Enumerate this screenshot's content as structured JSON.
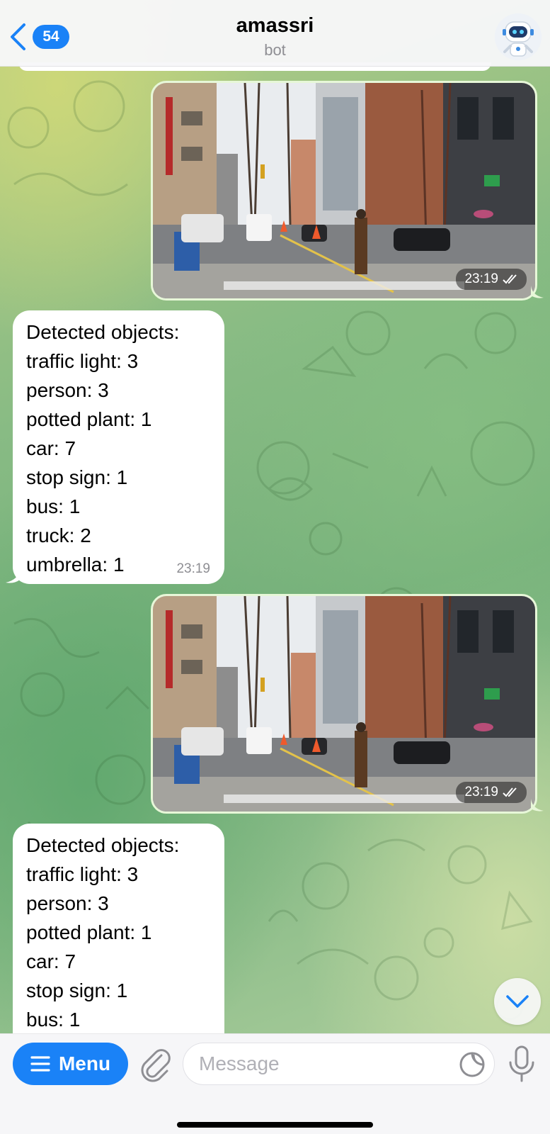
{
  "header": {
    "back_badge": "54",
    "title": "amassri",
    "subtitle": "bot",
    "icons": {
      "back": "chevron-left-icon",
      "avatar": "robot-avatar"
    }
  },
  "messages": [
    {
      "type": "photo",
      "time": "23:19",
      "status": "read-double-check"
    },
    {
      "type": "text",
      "lines": [
        "Detected objects:",
        "traffic light: 3",
        "person: 3",
        "potted plant: 1",
        "car: 7",
        "stop sign: 1",
        "bus: 1",
        "truck: 2",
        "umbrella: 1"
      ],
      "time": "23:19"
    },
    {
      "type": "photo",
      "time": "23:19",
      "status": "read-double-check"
    },
    {
      "type": "text",
      "lines": [
        "Detected objects:",
        "traffic light: 3",
        "person: 3",
        "potted plant: 1",
        "car: 7",
        "stop sign: 1",
        "bus: 1"
      ],
      "time": ""
    }
  ],
  "input_bar": {
    "menu_label": "Menu",
    "placeholder": "Message",
    "icons": [
      "menu-icon",
      "paperclip-icon",
      "sticker-icon",
      "microphone-icon"
    ]
  },
  "colors": {
    "accent": "#1a82f7",
    "outgoing_border": "#e7f7d8",
    "incoming_bubble": "#ffffff"
  }
}
